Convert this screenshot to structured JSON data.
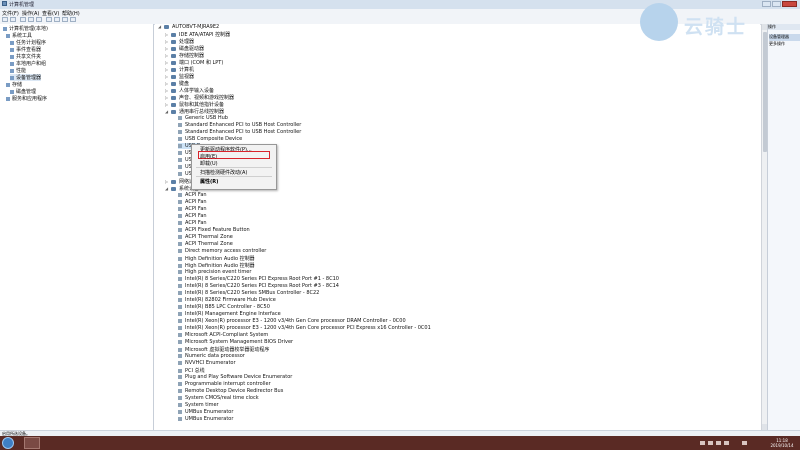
{
  "window": {
    "title": "计算机管理"
  },
  "menu": [
    "文件(F)",
    "操作(A)",
    "查看(V)",
    "帮助(H)"
  ],
  "left_tree": [
    "计算机管理(本地)",
    "系统工具",
    "任务计划程序",
    "事件查看器",
    "共享文件夹",
    "本地用户和组",
    "性能",
    "设备管理器",
    "存储",
    "磁盘管理",
    "服务和应用程序"
  ],
  "device_tree": {
    "root": "AUTOBVT-MJRA9E2",
    "categories": [
      "IDE ATA/ATAPI 控制器",
      "处理器",
      "磁盘驱动器",
      "存储控制器",
      "端口 (COM 和 LPT)",
      "计算机",
      "监视器",
      "键盘",
      "人体学输入设备",
      "声音、视频和游戏控制器",
      "鼠标和其他指针设备",
      "通用串行总线控制器"
    ],
    "usb_children": [
      "Generic USB Hub",
      "Standard Enhanced PCI to USB Host Controller",
      "Standard Enhanced PCI to USB Host Controller",
      "USB Composite Device",
      "USB R",
      "USB",
      "USB",
      "USB",
      "USB"
    ],
    "after_usb": [
      "网络适配器",
      "系统设备"
    ],
    "system_devices": [
      "ACPI Fan",
      "ACPI Fan",
      "ACPI Fan",
      "ACPI Fan",
      "ACPI Fan",
      "ACPI Fixed Feature Button",
      "ACPI Thermal Zone",
      "ACPI Thermal Zone",
      "Direct memory access controller",
      "High Definition Audio 控制器",
      "High Definition Audio 控制器",
      "High precision event timer",
      "Intel(R) 8 Series/C220 Series PCI Express Root Port #1 - 8C10",
      "Intel(R) 8 Series/C220 Series PCI Express Root Port #3 - 8C14",
      "Intel(R) 8 Series/C220 Series SMBus Controller - 8C22",
      "Intel(R) 82802 Firmware Hub Device",
      "Intel(R) B85 LPC Controller - 8C50",
      "Intel(R) Management Engine Interface",
      "Intel(R) Xeon(R) processor E3 - 1200 v3/4th Gen Core processor DRAM Controller - 0C00",
      "Intel(R) Xeon(R) processor E3 - 1200 v3/4th Gen Core processor PCI Express x16 Controller - 0C01",
      "Microsoft ACPI-Compliant System",
      "Microsoft System Management BIOS Driver",
      "Microsoft 虚拟驱动器枚举器驱动程序",
      "Numeric data processor",
      "NVVHCI Enumerator",
      "PCI 总线",
      "Plug and Play Software Device Enumerator",
      "Programmable interrupt controller",
      "Remote Desktop Device Redirector Bus",
      "System CMOS/real time clock",
      "System timer",
      "UMBus Enumerator",
      "UMBus Enumerator"
    ]
  },
  "context_menu": {
    "items": [
      "更新驱动程序软件(P)...",
      "启用(E)",
      "卸载(U)",
      "扫描检测硬件改动(A)",
      "属性(R)"
    ],
    "highlighted": "启用(E)"
  },
  "right_pane": {
    "header": "操作",
    "items": [
      "设备管理器",
      "更多操作"
    ]
  },
  "status": {
    "text": "启用所选设备。"
  },
  "clock": {
    "time": "11:18",
    "date": "2019/10/14"
  },
  "watermark": {
    "text": "云骑士"
  },
  "colors": {
    "highlight_box": "#d9232b",
    "taskbar": "#5a2a24",
    "titlebar": "#d5e1ee"
  }
}
